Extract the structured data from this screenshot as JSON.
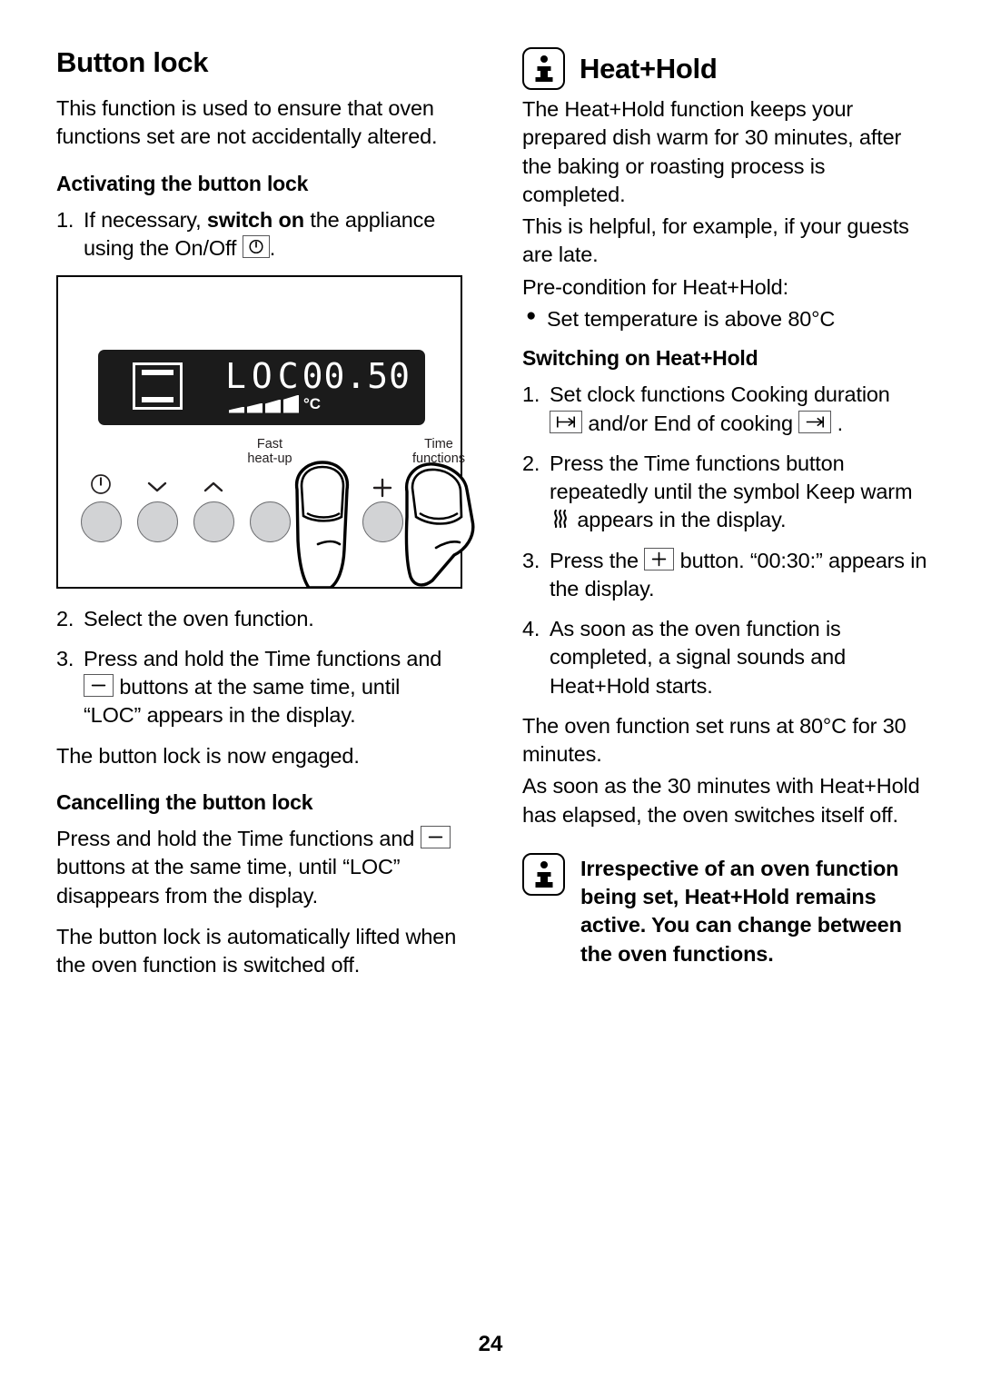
{
  "page": {
    "number": "24"
  },
  "left_column": {
    "title": "Button lock",
    "intro": "This function is used to ensure that oven functions set are not accidentally altered.",
    "activating_heading": "Activating the button lock",
    "step1_pre": "If necessary, ",
    "step1_bold": "switch on",
    "step1_post": " the appliance using the On/Off ",
    "step1_end": ".",
    "step1_num": "1.",
    "step2_num": "2.",
    "step2_text": "Select the oven function.",
    "step3_num": "3.",
    "step3_pre": "Press and hold the Time functions and ",
    "step3_post": " buttons at the same time, until “LOC” appears in the display.",
    "engaged_text": "The button lock is now engaged.",
    "cancelling_heading": "Cancelling the button lock",
    "cancel_pre": "Press and hold the Time functions and ",
    "cancel_post": " buttons at the same time, until “LOC” disappears from the display.",
    "auto_lift_text": "The button lock is automatically lifted when the oven function is switched off."
  },
  "figure": {
    "display": {
      "oven_symbol": "oven-top-bottom-heat-icon",
      "mode_text": "LOC",
      "clock_text": "00.50",
      "temperature_unit": "°C",
      "temperature_segments": 4
    },
    "buttons": [
      {
        "label": "",
        "glyph": "power-icon",
        "name": "on-off-button"
      },
      {
        "label": "",
        "glyph": "chevron-down-icon",
        "name": "decrease-button"
      },
      {
        "label": "",
        "glyph": "chevron-up-icon",
        "name": "increase-button"
      },
      {
        "label": "Fast\nheat-up",
        "glyph": "",
        "name": "fast-heat-up-button"
      },
      {
        "label": "",
        "glyph": "minus-icon",
        "name": "minus-button"
      },
      {
        "label": "",
        "glyph": "plus-icon",
        "name": "plus-button"
      },
      {
        "label": "Time\nfunctions",
        "glyph": "",
        "name": "time-functions-button"
      }
    ],
    "button_labels": {
      "fast_heat_up_line1": "Fast",
      "fast_heat_up_line2": "heat-up",
      "time_functions_line1": "Time",
      "time_functions_line2": "functions"
    },
    "fingers_pressing": [
      "minus-button",
      "time-functions-button"
    ]
  },
  "right_column": {
    "title": "Heat+Hold",
    "info_icon": "info-icon",
    "para1": "The Heat+Hold function keeps your prepared dish warm for 30 minutes, after the baking or roasting process is completed.",
    "para2": "This is helpful, for example, if your guests are late.",
    "precondition_lead": "Pre-condition for Heat+Hold:",
    "precondition_bullet": "Set temperature is above 80°C",
    "switching_heading": "Switching on Heat+Hold",
    "step1_num": "1.",
    "step1_pre": "Set clock functions Cooking duration ",
    "step1_mid": " and/or End of cooking ",
    "step1_post": " .",
    "step2_num": "2.",
    "step2_pre": "Press the Time functions button repeatedly until the symbol Keep warm ",
    "step2_post": " appears in the display.",
    "step3_num": "3.",
    "step3_pre": "Press the ",
    "step3_post": " button. “00:30:” appears in the display.",
    "step4_num": "4.",
    "step4_text": "As soon as the oven function is completed, a signal sounds and Heat+Hold starts.",
    "para3": "The oven function set runs at 80°C for 30 minutes.",
    "para4": "As soon as the 30 minutes with Heat+Hold has elapsed, the oven switches itself off.",
    "note_text": "Irrespective of an oven function being set, Heat+Hold remains active. You can change between the oven functions."
  }
}
